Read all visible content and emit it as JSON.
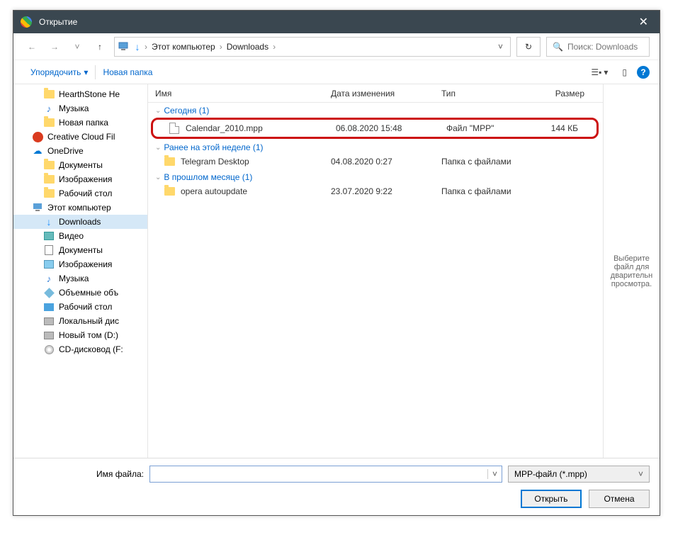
{
  "title": "Открытие",
  "breadcrumb": {
    "seg1": "Этот компьютер",
    "seg2": "Downloads"
  },
  "search_placeholder": "Поиск: Downloads",
  "cmd": {
    "organize": "Упорядочить",
    "newfolder": "Новая папка"
  },
  "tree": [
    {
      "label": "HearthStone  He",
      "icon": "folder",
      "lvl": 2
    },
    {
      "label": "Музыка",
      "icon": "music",
      "lvl": 2
    },
    {
      "label": "Новая папка",
      "icon": "folder",
      "lvl": 2
    },
    {
      "label": "Creative Cloud Fil",
      "icon": "cc",
      "lvl": 1
    },
    {
      "label": "OneDrive",
      "icon": "cloud",
      "lvl": 1
    },
    {
      "label": "Документы",
      "icon": "folder",
      "lvl": 2
    },
    {
      "label": "Изображения",
      "icon": "folder",
      "lvl": 2
    },
    {
      "label": "Рабочий стол",
      "icon": "folder",
      "lvl": 2
    },
    {
      "label": "Этот компьютер",
      "icon": "pc",
      "lvl": 1
    },
    {
      "label": "Downloads",
      "icon": "dl",
      "lvl": 2,
      "sel": true
    },
    {
      "label": "Видео",
      "icon": "video",
      "lvl": 2
    },
    {
      "label": "Документы",
      "icon": "docs",
      "lvl": 2
    },
    {
      "label": "Изображения",
      "icon": "pics",
      "lvl": 2
    },
    {
      "label": "Музыка",
      "icon": "music",
      "lvl": 2
    },
    {
      "label": "Объемные объ",
      "icon": "3d",
      "lvl": 2
    },
    {
      "label": "Рабочий стол",
      "icon": "desk",
      "lvl": 2
    },
    {
      "label": "Локальный дис",
      "icon": "disk",
      "lvl": 2
    },
    {
      "label": "Новый том (D:)",
      "icon": "disk",
      "lvl": 2
    },
    {
      "label": "CD-дисковод (F:",
      "icon": "cd",
      "lvl": 2
    }
  ],
  "columns": {
    "name": "Имя",
    "date": "Дата изменения",
    "type": "Тип",
    "size": "Размер"
  },
  "groups": [
    {
      "title": "Сегодня (1)",
      "items": [
        {
          "name": "Calendar_2010.mpp",
          "date": "06.08.2020 15:48",
          "type": "Файл \"MPP\"",
          "size": "144 КБ",
          "icon": "file",
          "hl": true
        }
      ]
    },
    {
      "title": "Ранее на этой неделе (1)",
      "items": [
        {
          "name": "Telegram Desktop",
          "date": "04.08.2020 0:27",
          "type": "Папка с файлами",
          "size": "",
          "icon": "folder"
        }
      ]
    },
    {
      "title": "В прошлом месяце (1)",
      "items": [
        {
          "name": "opera autoupdate",
          "date": "23.07.2020 9:22",
          "type": "Папка с файлами",
          "size": "",
          "icon": "folder"
        }
      ]
    }
  ],
  "preview_text": "Выберите файл для дварительн просмотра.",
  "footer": {
    "filename_label": "Имя файла:",
    "filetype": "MPP-файл (*.mpp)",
    "open": "Открыть",
    "cancel": "Отмена"
  }
}
